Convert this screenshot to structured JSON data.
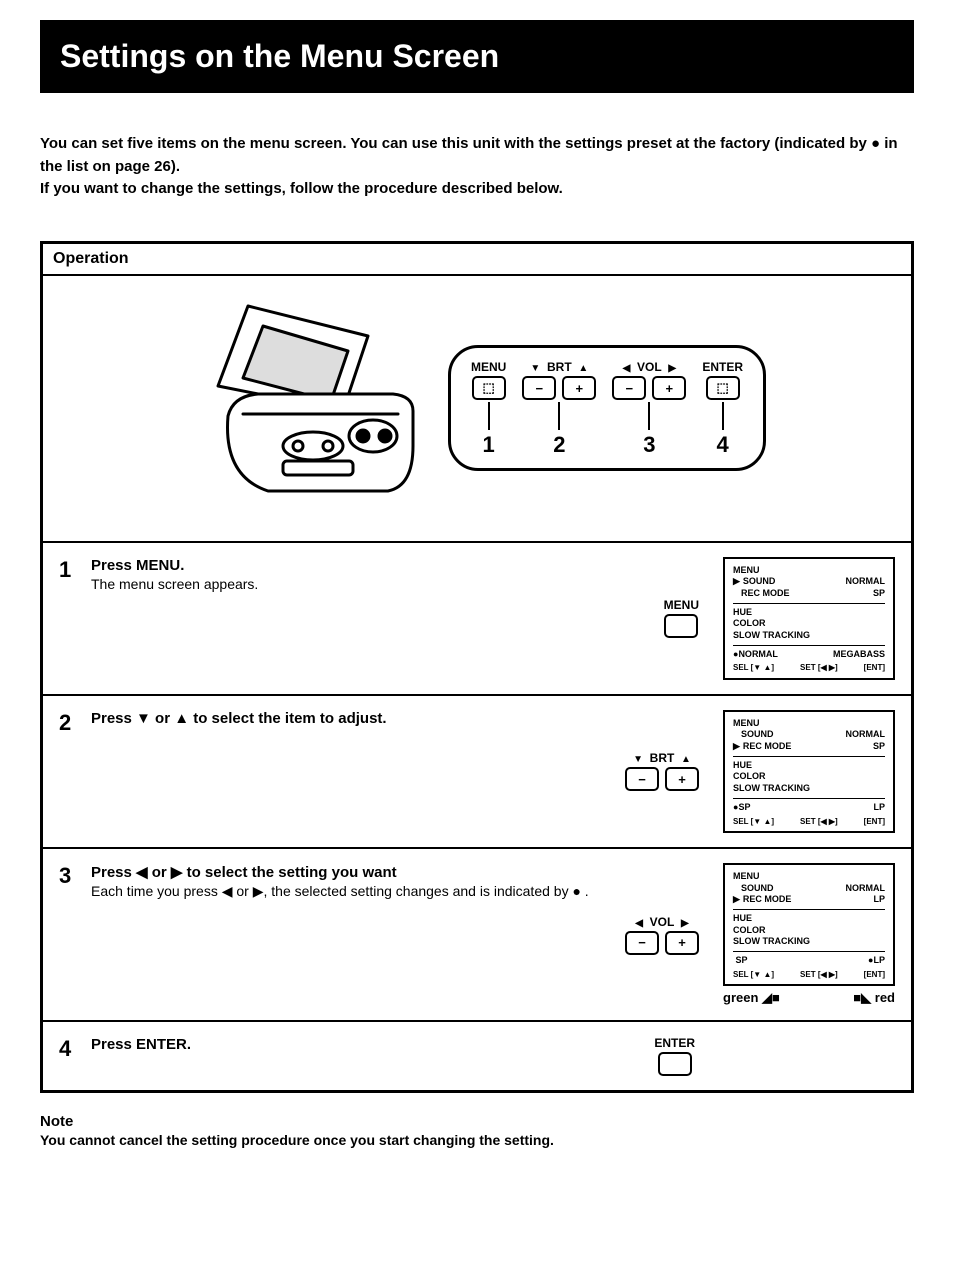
{
  "title": "Settings on the Menu Screen",
  "intro_line1": "You can set five items on the menu screen. You can use this unit with the settings preset at the factory (indicated by ● in the list on page 26).",
  "intro_line2": "If you want to change the settings, follow the procedure described below.",
  "operation_label": "Operation",
  "controls": {
    "menu": "MENU",
    "brt": "BRT",
    "vol": "VOL",
    "enter": "ENTER",
    "nums": [
      "1",
      "2",
      "3",
      "4"
    ]
  },
  "steps": [
    {
      "num": "1",
      "title": "Press MENU.",
      "desc": "The menu screen appears.",
      "btn_label": "MENU"
    },
    {
      "num": "2",
      "title": "Press ▼ or ▲ to select the item to adjust.",
      "btn_label": "BRT"
    },
    {
      "num": "3",
      "title": "Press ◀ or ▶ to select the setting you want",
      "desc": "Each time you press ◀ or ▶, the selected setting changes and is indicated by ● .",
      "btn_label": "VOL",
      "color_left": "green",
      "color_right": "red"
    },
    {
      "num": "4",
      "title": "Press ENTER.",
      "btn_label": "ENTER"
    }
  ],
  "osd": {
    "title": "MENU",
    "items": {
      "sound": "SOUND",
      "recmode": "REC MODE",
      "hue": "HUE",
      "color": "COLOR",
      "slowtracking": "SLOW TRACKING"
    },
    "vals": {
      "normal": "NORMAL",
      "sp": "SP",
      "lp": "LP",
      "megabass": "MEGABASS"
    },
    "footer": {
      "sel": "SEL [▼ ▲]",
      "set": "SET [◀ ▶]",
      "ent": "[ENT]"
    }
  },
  "note": {
    "title": "Note",
    "body": "You cannot cancel the setting procedure once you start changing the setting."
  }
}
